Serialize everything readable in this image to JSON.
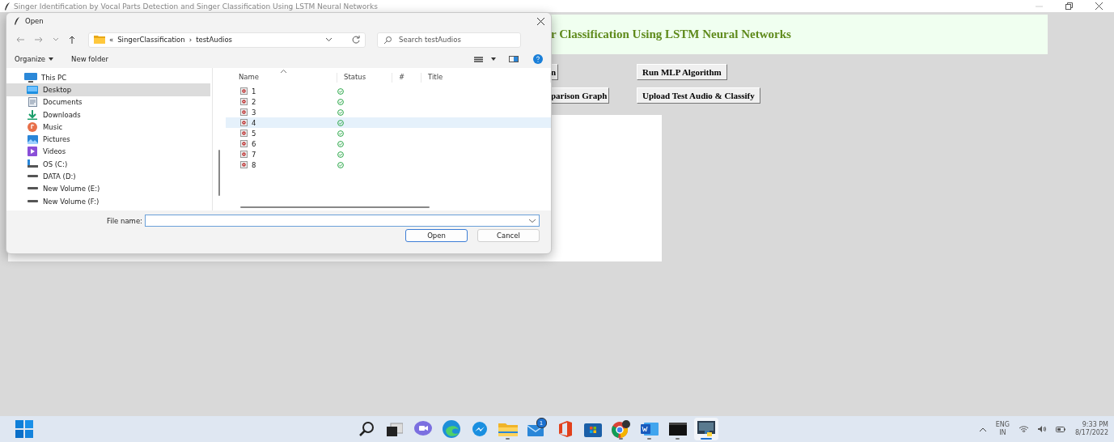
{
  "app": {
    "title": "Singer Identification by Vocal Parts Detection and Singer Classification Using LSTM Neural Networks",
    "heading": "r Classification Using LSTM Neural Networks",
    "buttons": [
      "n",
      "Run MLP Algorithm",
      "parison Graph",
      "Upload Test Audio & Classify"
    ]
  },
  "dialog": {
    "title": "Open",
    "path_prefix": "«",
    "path": [
      "SingerClassification",
      "testAudios"
    ],
    "separator": "›",
    "search": {
      "placeholder": "Search testAudios"
    },
    "toolbar": {
      "organize": "Organize",
      "new_folder": "New folder"
    },
    "nav": [
      {
        "label": "This PC",
        "kind": "pc",
        "selected": false,
        "children": [
          {
            "label": "Desktop",
            "kind": "desktop",
            "selected": true
          },
          {
            "label": "Documents",
            "kind": "documents",
            "selected": false
          },
          {
            "label": "Downloads",
            "kind": "downloads",
            "selected": false
          },
          {
            "label": "Music",
            "kind": "music",
            "selected": false
          },
          {
            "label": "Pictures",
            "kind": "pictures",
            "selected": false
          },
          {
            "label": "Videos",
            "kind": "videos",
            "selected": false
          },
          {
            "label": "OS (C:)",
            "kind": "system-drive",
            "selected": false
          },
          {
            "label": "DATA (D:)",
            "kind": "drive",
            "selected": false
          },
          {
            "label": "New Volume (E:)",
            "kind": "drive",
            "selected": false
          },
          {
            "label": "New Volume (F:)",
            "kind": "drive",
            "selected": false
          }
        ]
      }
    ],
    "columns": [
      "Name",
      "Status",
      "#",
      "Title"
    ],
    "files": [
      {
        "name": "1",
        "selected": false
      },
      {
        "name": "2",
        "selected": false
      },
      {
        "name": "3",
        "selected": false
      },
      {
        "name": "4",
        "selected": true
      },
      {
        "name": "5",
        "selected": false
      },
      {
        "name": "6",
        "selected": false
      },
      {
        "name": "7",
        "selected": false
      },
      {
        "name": "8",
        "selected": false
      }
    ],
    "file_name_label": "File name:",
    "buttons": [
      "Open",
      "Cancel"
    ]
  },
  "taskbar": {
    "apps": [
      {
        "kind": "start",
        "running": false,
        "active": false
      },
      {
        "kind": "search",
        "running": false,
        "active": false
      },
      {
        "kind": "task-view",
        "running": false,
        "active": false
      },
      {
        "kind": "chat",
        "running": false,
        "active": false
      },
      {
        "kind": "edge",
        "running": false,
        "active": false
      },
      {
        "kind": "messenger",
        "running": false,
        "active": false
      },
      {
        "kind": "folder",
        "running": true,
        "active": false
      },
      {
        "kind": "mail",
        "badge": "1",
        "running": false,
        "active": false
      },
      {
        "kind": "office",
        "running": false,
        "active": false
      },
      {
        "kind": "store",
        "running": false,
        "active": false
      },
      {
        "kind": "chrome",
        "running": true,
        "active": false
      },
      {
        "kind": "word",
        "running": true,
        "active": false
      },
      {
        "kind": "terminal",
        "running": true,
        "active": false
      },
      {
        "kind": "python",
        "running": true,
        "active": true
      }
    ],
    "tray": {
      "language": "ENG",
      "region": "IN",
      "time": "9:33 PM",
      "date": "8/17/2022"
    }
  }
}
